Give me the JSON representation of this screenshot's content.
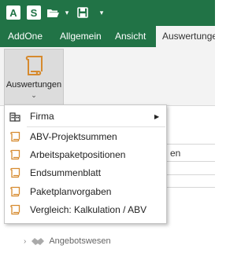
{
  "quick_access": {
    "app_letter_a": "A",
    "app_letter_s": "S",
    "caret": "▾"
  },
  "ribbon": {
    "tabs": [
      {
        "label": "AddOne"
      },
      {
        "label": "Allgemein"
      },
      {
        "label": "Ansicht"
      },
      {
        "label": "Auswertungen",
        "active": true
      }
    ],
    "button": {
      "label": "Auswertungen",
      "caret": "⌄"
    }
  },
  "background": {
    "partial_label": "en",
    "group_label": "Angebotswesen",
    "chevron": "›"
  },
  "menu": {
    "firma": {
      "label": "Firma",
      "arrow": "▶"
    },
    "items": [
      {
        "label": "ABV-Projektsummen"
      },
      {
        "label": "Arbeitspaketpositionen"
      },
      {
        "label": "Endsummenblatt"
      },
      {
        "label": "Paketplanvorgaben"
      },
      {
        "label": "Vergleich: Kalkulation / ABV"
      }
    ]
  },
  "colors": {
    "accent": "#217346",
    "icon_orange": "#d68a2e"
  }
}
